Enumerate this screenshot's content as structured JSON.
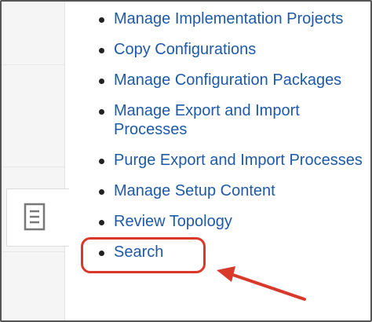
{
  "menu": {
    "items": [
      {
        "label": "Manage Implementation Projects"
      },
      {
        "label": "Copy Configurations"
      },
      {
        "label": "Manage Configuration Packages"
      },
      {
        "label": "Manage Export and Import Processes"
      },
      {
        "label": "Purge Export and Import Processes"
      },
      {
        "label": "Manage Setup Content"
      },
      {
        "label": "Review Topology"
      },
      {
        "label": "Search"
      }
    ]
  },
  "icons": {
    "side_tab": "document-icon",
    "annotation": "red-arrow-icon"
  },
  "colors": {
    "link": "#1e5aa8",
    "highlight": "#d8392b"
  }
}
